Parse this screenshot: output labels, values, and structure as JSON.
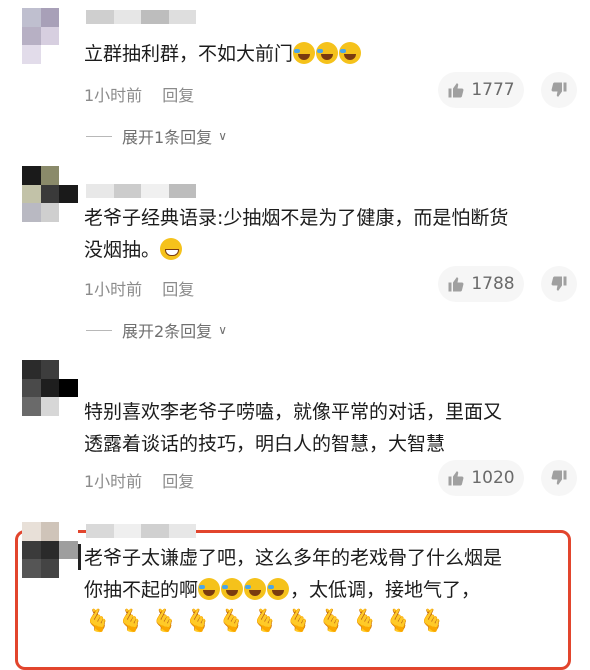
{
  "comments": [
    {
      "text_a": "立群抽利群，不如大前门",
      "emoji_count": 3,
      "time": "1小时前",
      "reply": "回复",
      "likes": "1777",
      "expand": "展开1条回复"
    },
    {
      "text_a": "老爷子经典语录:少抽烟不是为了健康，而是怕断货\n没烟抽。",
      "time": "1小时前",
      "reply": "回复",
      "likes": "1788",
      "expand": "展开2条回复"
    },
    {
      "text_a": "特别喜欢李老爷子唠嗑，就像平常的对话，里面又\n透露着谈话的技巧，明白人的智慧，大智慧",
      "time": "1小时前",
      "reply": "回复",
      "likes": "1020"
    },
    {
      "text_a": "老爷子太谦虚了吧，这么多年的老戏骨了什么烟是",
      "text_b": "你抽不起的啊",
      "text_c": "，太低调，接地气了，",
      "emoji_count": 4,
      "hand_count": 11
    }
  ],
  "colors": {
    "highlight": "#e2452d",
    "meta": "#8b8b8b",
    "pill": "#f6f6f6"
  },
  "icons": [
    "thumb-up-icon",
    "thumb-down-icon",
    "chevron-down-icon",
    "laugh-cry-emoji",
    "grin-emoji",
    "finger-heart-emoji"
  ]
}
